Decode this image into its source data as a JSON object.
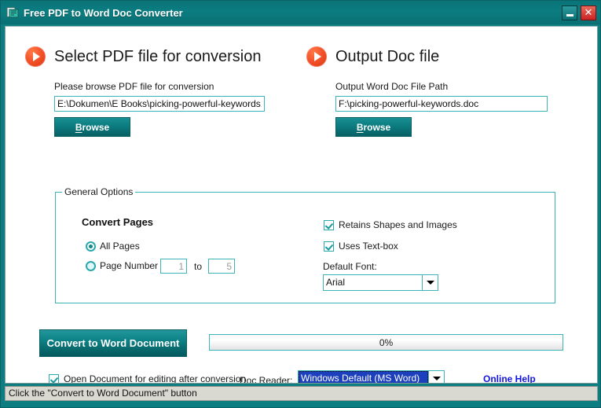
{
  "window": {
    "title": "Free PDF to Word Doc Converter",
    "app_icon": "app-document-icon",
    "minimize_label": "–",
    "close_label": "✕",
    "accent_teal": "#0c7d81",
    "accent_orange": "#f4522a",
    "link_blue": "#1414e0",
    "border_teal": "#3cb4b8"
  },
  "input_section": {
    "icon": "play-bullet-icon",
    "heading": "Select PDF file for conversion",
    "field_label": "Please browse PDF file for conversion",
    "path_value": "E:\\Dokumen\\E Books\\picking-powerful-keywords.pdf",
    "path_placeholder": "",
    "browse_label": "Browse",
    "browse_accesskey": "B",
    "browse_rest": "rowse"
  },
  "output_section": {
    "icon": "play-bullet-icon",
    "heading": "Output Doc file",
    "field_label": "Output Word Doc File Path",
    "path_value": "F:\\picking-powerful-keywords.doc",
    "path_placeholder": "",
    "browse_label": "Browse",
    "browse_accesskey": "B",
    "browse_rest": "rowse"
  },
  "general_options": {
    "legend": "General Options",
    "convert_pages_heading": "Convert Pages",
    "radio_all_pages": {
      "label": "All Pages",
      "checked": true
    },
    "radio_page_number": {
      "label": "Page Number",
      "checked": false
    },
    "page_from_value": "1",
    "page_to_value": "5",
    "to_label": "to",
    "checkbox_retains_shapes": {
      "label": "Retains Shapes and Images",
      "checked": true
    },
    "checkbox_uses_textbox": {
      "label": "Uses Text-box",
      "checked": true
    },
    "default_font_label": "Default Font:",
    "default_font_value": "Arial"
  },
  "actions": {
    "convert_label": "Convert to Word Document",
    "progress_text": "0%",
    "progress_percent": 0,
    "open_after_conversion": {
      "label": "Open Document for editing after conversion",
      "checked": true
    },
    "doc_reader_label": "Doc Reader:",
    "doc_reader_value": "Windows Default (MS Word)",
    "online_help_label": "Online Help"
  },
  "statusbar": {
    "text": "Click the \"Convert to Word Document\" button"
  }
}
